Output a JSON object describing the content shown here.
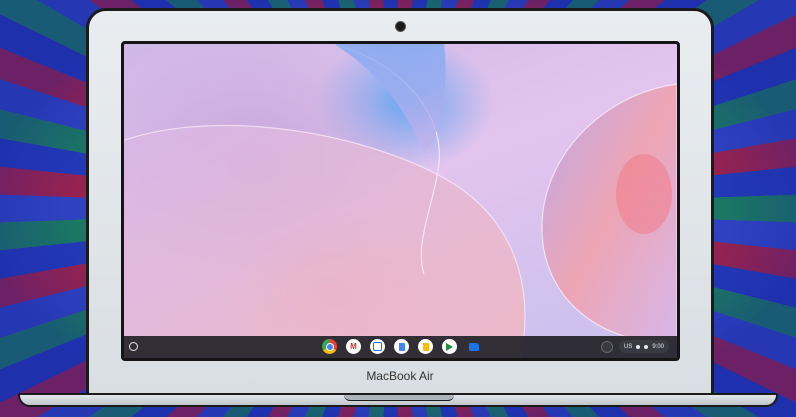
{
  "device": {
    "brand_label": "MacBook Air"
  },
  "shelf": {
    "apps": [
      {
        "name": "chrome-icon"
      },
      {
        "name": "gmail-icon",
        "glyph": "M"
      },
      {
        "name": "calendar-icon"
      },
      {
        "name": "docs-icon"
      },
      {
        "name": "keep-icon"
      },
      {
        "name": "play-store-icon"
      },
      {
        "name": "files-icon"
      }
    ],
    "tray": {
      "locale": "US",
      "time": "9:00"
    }
  },
  "colors": {
    "shelf_bg": "#222228",
    "frame": "#e9edf0",
    "accent_blue": "#4285f4"
  }
}
